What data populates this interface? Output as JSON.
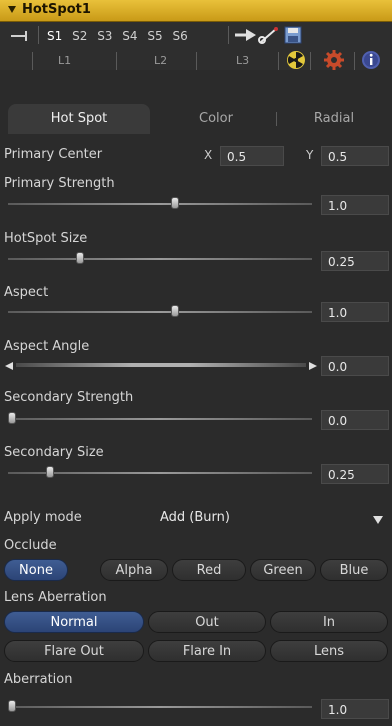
{
  "titlebar": {
    "title": "HotSpot1"
  },
  "toolbar": {
    "version_buttons": [
      "S1",
      "S2",
      "S3",
      "S4",
      "S5",
      "S6"
    ],
    "active_version": "S1",
    "light_labels": [
      "L1",
      "L2",
      "L3"
    ]
  },
  "tabs": [
    {
      "label": "Hot Spot",
      "active": true
    },
    {
      "label": "Color",
      "active": false
    },
    {
      "label": "Radial",
      "active": false
    }
  ],
  "primary_center": {
    "label": "Primary Center",
    "x_label": "X",
    "x_value": "0.5",
    "y_label": "Y",
    "y_value": "0.5"
  },
  "sliders": [
    {
      "label": "Primary Strength",
      "value": "1.0",
      "level": 0.55
    },
    {
      "label": "HotSpot Size",
      "value": "0.25",
      "level": 0.23
    },
    {
      "label": "Aspect",
      "value": "1.0",
      "level": 0.55
    },
    {
      "label": "Aspect Angle",
      "value": "0.0",
      "level": 0.0
    },
    {
      "label": "Secondary Strength",
      "value": "0.0",
      "level": 0.0
    },
    {
      "label": "Secondary Size",
      "value": "0.25",
      "level": 0.13
    },
    {
      "label": "Aberration",
      "value": "1.0",
      "level": 0.0
    }
  ],
  "apply_mode": {
    "label": "Apply mode",
    "value": "Add (Burn)"
  },
  "occlude": {
    "label": "Occlude",
    "options": [
      "None",
      "Alpha",
      "Red",
      "Green",
      "Blue"
    ],
    "selected": "None"
  },
  "lens_aberration": {
    "label": "Lens Aberration",
    "row1": [
      "Normal",
      "Out",
      "In"
    ],
    "row2": [
      "Flare Out",
      "Flare In",
      "Lens"
    ],
    "selected": "Normal"
  },
  "colors": {
    "accent": "#e0b52a",
    "active_button": "#3a5487",
    "background": "#2b2b2b"
  }
}
